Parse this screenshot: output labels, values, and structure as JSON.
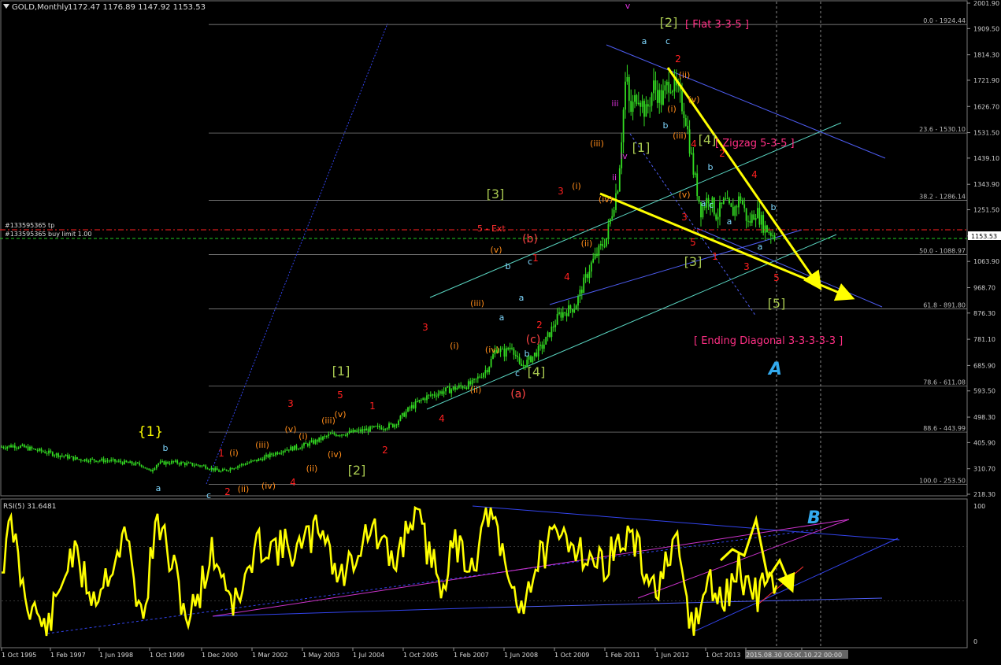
{
  "header": {
    "symbol": "GOLD,Monthly",
    "ohlc": "1172.47 1176.89 1147.92 1153.53"
  },
  "rsi_header": "RSI(5) 31.6481",
  "colors": {
    "background": "#000000",
    "candle": "#33dd22",
    "fib": "#c8c8c8",
    "yellow": "#ffff00",
    "wave_red": "#ff2020",
    "wave_orange": "#ff8c1a",
    "wave_green": "#a8c850",
    "wave_cyan": "#7fd8ff",
    "wave_magenta": "#dd33dd",
    "pink": "#ff2f84",
    "blue_line": "#4d5cf0",
    "aqua_line": "#5ad6c2",
    "annot_blue": "#33aaee"
  },
  "order_lines": [
    {
      "label": "#133595365 tp",
      "style": "red-dashdot"
    },
    {
      "label": "#133595365 buy limit 1.00",
      "style": "green-dashed"
    }
  ],
  "current_price": "1153.53",
  "annotations": {
    "flat": "[ Flat 3-3-5 ]",
    "zigzag": "[ Zigzag 5-3-5 ]",
    "ending": "[ Ending Diagonal 3-3-3-3-3 ]",
    "ext": "5 - Ext",
    "A": "A",
    "B": "B"
  },
  "wave_labels": [
    {
      "t": "{1}",
      "c": "yellow",
      "p": [
        191,
        554
      ],
      "s": 17
    },
    {
      "t": "b",
      "c": "cyan",
      "p": [
        210,
        573
      ],
      "s": 11
    },
    {
      "t": "a",
      "c": "cyan",
      "p": [
        201,
        624
      ],
      "s": 11
    },
    {
      "t": "c",
      "c": "cyan",
      "p": [
        265,
        633
      ],
      "s": 11
    },
    {
      "t": "1",
      "c": "red",
      "p": [
        281,
        580
      ],
      "s": 12
    },
    {
      "t": "2",
      "c": "red",
      "p": [
        289,
        629
      ],
      "s": 12
    },
    {
      "t": "(i)",
      "c": "orange",
      "p": [
        297,
        579
      ],
      "s": 11
    },
    {
      "t": "(ii)",
      "c": "orange",
      "p": [
        309,
        625
      ],
      "s": 11
    },
    {
      "t": "(iii)",
      "c": "orange",
      "p": [
        333,
        569
      ],
      "s": 11
    },
    {
      "t": "(iv)",
      "c": "orange",
      "p": [
        341,
        621
      ],
      "s": 11
    },
    {
      "t": "(v)",
      "c": "orange",
      "p": [
        369,
        549
      ],
      "s": 11
    },
    {
      "t": "3",
      "c": "red",
      "p": [
        369,
        517
      ],
      "s": 12
    },
    {
      "t": "4",
      "c": "red",
      "p": [
        372,
        617
      ],
      "s": 12
    },
    {
      "t": "(i)",
      "c": "orange",
      "p": [
        385,
        558
      ],
      "s": 11
    },
    {
      "t": "(ii)",
      "c": "orange",
      "p": [
        396,
        599
      ],
      "s": 11
    },
    {
      "t": "(iii)",
      "c": "orange",
      "p": [
        417,
        538
      ],
      "s": 11
    },
    {
      "t": "(iv)",
      "c": "orange",
      "p": [
        425,
        581
      ],
      "s": 11
    },
    {
      "t": "(v)",
      "c": "orange",
      "p": [
        432,
        530
      ],
      "s": 11
    },
    {
      "t": "5",
      "c": "red",
      "p": [
        432,
        506
      ],
      "s": 12
    },
    {
      "t": "[1]",
      "c": "green",
      "p": [
        433,
        477
      ],
      "s": 16
    },
    {
      "t": "[2]",
      "c": "green",
      "p": [
        453,
        603
      ],
      "s": 16
    },
    {
      "t": "1",
      "c": "red",
      "p": [
        473,
        520
      ],
      "s": 12
    },
    {
      "t": "2",
      "c": "red",
      "p": [
        489,
        576
      ],
      "s": 12
    },
    {
      "t": "3",
      "c": "red",
      "p": [
        540,
        420
      ],
      "s": 12
    },
    {
      "t": "4",
      "c": "red",
      "p": [
        561,
        536
      ],
      "s": 12
    },
    {
      "t": "(i)",
      "c": "orange",
      "p": [
        577,
        443
      ],
      "s": 11
    },
    {
      "t": "(ii)",
      "c": "orange",
      "p": [
        604,
        499
      ],
      "s": 11
    },
    {
      "t": "(iii)",
      "c": "orange",
      "p": [
        606,
        389
      ],
      "s": 11
    },
    {
      "t": "(iv)",
      "c": "orange",
      "p": [
        625,
        448
      ],
      "s": 11
    },
    {
      "t": "(v)",
      "c": "orange",
      "p": [
        630,
        321
      ],
      "s": 11
    },
    {
      "t": "[3]",
      "c": "green",
      "p": [
        629,
        252
      ],
      "s": 16
    },
    {
      "t": "b",
      "c": "cyan",
      "p": [
        645,
        342
      ],
      "s": 11
    },
    {
      "t": "a",
      "c": "cyan",
      "p": [
        637,
        407
      ],
      "s": 11
    },
    {
      "t": "a",
      "c": "cyan",
      "p": [
        662,
        382
      ],
      "s": 11
    },
    {
      "t": "c",
      "c": "cyan",
      "p": [
        673,
        336
      ],
      "s": 11
    },
    {
      "t": "b",
      "c": "cyan",
      "p": [
        669,
        453
      ],
      "s": 11
    },
    {
      "t": "c",
      "c": "cyan",
      "p": [
        657,
        478
      ],
      "s": 11
    },
    {
      "t": "[4]",
      "c": "green",
      "p": [
        681,
        478
      ],
      "s": 16
    },
    {
      "t": "(a)",
      "c": "pinkred",
      "p": [
        658,
        505
      ],
      "s": 14
    },
    {
      "t": "(b)",
      "c": "pinkred",
      "p": [
        673,
        308
      ],
      "s": 14
    },
    {
      "t": "(c)",
      "c": "pinkred",
      "p": [
        677,
        436
      ],
      "s": 14
    },
    {
      "t": "1",
      "c": "red",
      "p": [
        680,
        332
      ],
      "s": 12
    },
    {
      "t": "2",
      "c": "red",
      "p": [
        685,
        417
      ],
      "s": 12
    },
    {
      "t": "3",
      "c": "red",
      "p": [
        712,
        247
      ],
      "s": 12
    },
    {
      "t": "4",
      "c": "red",
      "p": [
        720,
        356
      ],
      "s": 12
    },
    {
      "t": "(i)",
      "c": "orange",
      "p": [
        732,
        240
      ],
      "s": 11
    },
    {
      "t": "(ii)",
      "c": "orange",
      "p": [
        745,
        313
      ],
      "s": 11
    },
    {
      "t": "(iii)",
      "c": "orange",
      "p": [
        758,
        186
      ],
      "s": 11
    },
    {
      "t": "(iv)",
      "c": "orange",
      "p": [
        769,
        257
      ],
      "s": 11
    },
    {
      "t": "iii",
      "c": "magenta",
      "p": [
        781,
        135
      ],
      "s": 11
    },
    {
      "t": "ii",
      "c": "magenta",
      "p": [
        780,
        229
      ],
      "s": 11
    },
    {
      "t": "iv",
      "c": "magenta",
      "p": [
        792,
        202
      ],
      "s": 11
    },
    {
      "t": "v",
      "c": "magenta",
      "p": [
        797,
        11
      ],
      "s": 11
    },
    {
      "t": "a",
      "c": "cyan",
      "p": [
        818,
        56
      ],
      "s": 11
    },
    {
      "t": "c",
      "c": "cyan",
      "p": [
        848,
        56
      ],
      "s": 11
    },
    {
      "t": "[2]",
      "c": "green",
      "p": [
        849,
        34
      ],
      "s": 16
    },
    {
      "t": "b",
      "c": "cyan",
      "p": [
        845,
        163
      ],
      "s": 11
    },
    {
      "t": "2",
      "c": "red",
      "p": [
        861,
        79
      ],
      "s": 12
    },
    {
      "t": "(ii)",
      "c": "orange",
      "p": [
        869,
        99
      ],
      "s": 11
    },
    {
      "t": "(v)",
      "c": "orange",
      "p": [
        881,
        130
      ],
      "s": 11
    },
    {
      "t": "(i)",
      "c": "orange",
      "p": [
        853,
        142
      ],
      "s": 11
    },
    {
      "t": "(iii)",
      "c": "orange",
      "p": [
        863,
        176
      ],
      "s": 11
    },
    {
      "t": "[1]",
      "c": "green",
      "p": [
        814,
        193
      ],
      "s": 16
    },
    {
      "t": "[4]",
      "c": "green",
      "p": [
        898,
        183
      ],
      "s": 16
    },
    {
      "t": "4",
      "c": "red",
      "p": [
        881,
        187
      ],
      "s": 12
    },
    {
      "t": "2",
      "c": "red",
      "p": [
        917,
        199
      ],
      "s": 12
    },
    {
      "t": "b",
      "c": "cyan",
      "p": [
        902,
        216
      ],
      "s": 11
    },
    {
      "t": "a",
      "c": "cyan",
      "p": [
        893,
        262
      ],
      "s": 11
    },
    {
      "t": "(v)",
      "c": "orange",
      "p": [
        869,
        251
      ],
      "s": 11
    },
    {
      "t": "3",
      "c": "red",
      "p": [
        869,
        280
      ],
      "s": 12
    },
    {
      "t": "c",
      "c": "cyan",
      "p": [
        903,
        264
      ],
      "s": 11
    },
    {
      "t": "a",
      "c": "cyan",
      "p": [
        926,
        285
      ],
      "s": 11
    },
    {
      "t": "4",
      "c": "red",
      "p": [
        958,
        226
      ],
      "s": 12
    },
    {
      "t": "b",
      "c": "cyan",
      "p": [
        982,
        267
      ],
      "s": 11
    },
    {
      "t": "a",
      "c": "cyan",
      "p": [
        965,
        317
      ],
      "s": 11
    },
    {
      "t": "5",
      "c": "red",
      "p": [
        880,
        312
      ],
      "s": 12
    },
    {
      "t": "[3]",
      "c": "green",
      "p": [
        880,
        338
      ],
      "s": 16
    },
    {
      "t": "1",
      "c": "red",
      "p": [
        908,
        330
      ],
      "s": 12
    },
    {
      "t": "3",
      "c": "red",
      "p": [
        948,
        343
      ],
      "s": 12
    },
    {
      "t": "5",
      "c": "red",
      "p": [
        986,
        357
      ],
      "s": 12
    },
    {
      "t": "[5]",
      "c": "green",
      "p": [
        986,
        391
      ],
      "s": 16
    }
  ],
  "chart_data": [
    {
      "type": "candlestick",
      "title": "GOLD,Monthly",
      "ylim": [
        218.3,
        2001.9
      ],
      "y_ticks": [
        218.3,
        310.7,
        405.9,
        498.3,
        593.5,
        685.9,
        781.1,
        876.3,
        968.7,
        1063.9,
        1156.3,
        1251.5,
        1343.9,
        1439.1,
        1531.5,
        1626.7,
        1721.9,
        1814.3,
        1909.5,
        2001.9
      ],
      "y_tick_labels": [
        "218.30",
        "310.70",
        "405.90",
        "498.30",
        "593.50",
        "685.90",
        "781.10",
        "876.30",
        "968.70",
        "1063.90",
        "1156.30",
        "1251.50",
        "1343.90",
        "1439.10",
        "1531.50",
        "1626.70",
        "1721.90",
        "1814.30",
        "1909.50",
        "2001.90"
      ],
      "x_tick_labels": [
        "1 Oct 1995",
        "1 Feb 1997",
        "1 Jun 1998",
        "1 Oct 1999",
        "1 Dec 2000",
        "1 Mar 2002",
        "1 May 2003",
        "1 Jul 2004",
        "1 Oct 2005",
        "1 Feb 2007",
        "1 Jun 2008",
        "1 Oct 2009",
        "1 Feb 2011",
        "1 Jun 2012",
        "1 Oct 2013",
        "2015.08.30 00:00",
        ".10.22 00:00"
      ],
      "fib_levels": [
        {
          "label": "0.0 - 1924.44",
          "value": 1924.44
        },
        {
          "label": "23.6 - 1530.10",
          "value": 1530.1
        },
        {
          "label": "38.2 - 1286.14",
          "value": 1286.14
        },
        {
          "label": "50.0 - 1088.97",
          "value": 1088.97
        },
        {
          "label": "61.8 - 891.80",
          "value": 891.8
        },
        {
          "label": "78.6 - 611.08",
          "value": 611.08
        },
        {
          "label": "88.6 - 443.99",
          "value": 443.99
        },
        {
          "label": "100.0 - 253.50",
          "value": 253.5
        }
      ],
      "close_series": [
        [
          0,
          390
        ],
        [
          20,
          395
        ],
        [
          60,
          370
        ],
        [
          100,
          345
        ],
        [
          140,
          340
        ],
        [
          180,
          325
        ],
        [
          190,
          300
        ],
        [
          200,
          330
        ],
        [
          220,
          335
        ],
        [
          260,
          320
        ],
        [
          280,
          300
        ],
        [
          300,
          320
        ],
        [
          330,
          345
        ],
        [
          360,
          380
        ],
        [
          380,
          390
        ],
        [
          400,
          410
        ],
        [
          420,
          435
        ],
        [
          440,
          440
        ],
        [
          470,
          455
        ],
        [
          500,
          470
        ],
        [
          520,
          530
        ],
        [
          540,
          570
        ],
        [
          560,
          590
        ],
        [
          600,
          620
        ],
        [
          620,
          680
        ],
        [
          630,
          750
        ],
        [
          640,
          730
        ],
        [
          650,
          760
        ],
        [
          660,
          680
        ],
        [
          670,
          700
        ],
        [
          690,
          760
        ],
        [
          710,
          870
        ],
        [
          730,
          900
        ],
        [
          750,
          1050
        ],
        [
          770,
          1150
        ],
        [
          785,
          1350
        ],
        [
          795,
          1750
        ],
        [
          800,
          1600
        ],
        [
          810,
          1680
        ],
        [
          820,
          1600
        ],
        [
          830,
          1700
        ],
        [
          840,
          1650
        ],
        [
          850,
          1720
        ],
        [
          860,
          1680
        ],
        [
          870,
          1600
        ],
        [
          880,
          1400
        ],
        [
          890,
          1250
        ],
        [
          900,
          1300
        ],
        [
          910,
          1230
        ],
        [
          920,
          1280
        ],
        [
          930,
          1240
        ],
        [
          940,
          1300
        ],
        [
          950,
          1200
        ],
        [
          960,
          1250
        ],
        [
          970,
          1190
        ],
        [
          985,
          1153.53
        ]
      ]
    },
    {
      "type": "line",
      "title": "RSI(5) 31.6481",
      "ylim": [
        0,
        100
      ],
      "y_tick_labels": [
        "100",
        "0"
      ],
      "series": [
        {
          "name": "RSI(5)",
          "last": 31.6481
        }
      ]
    }
  ]
}
